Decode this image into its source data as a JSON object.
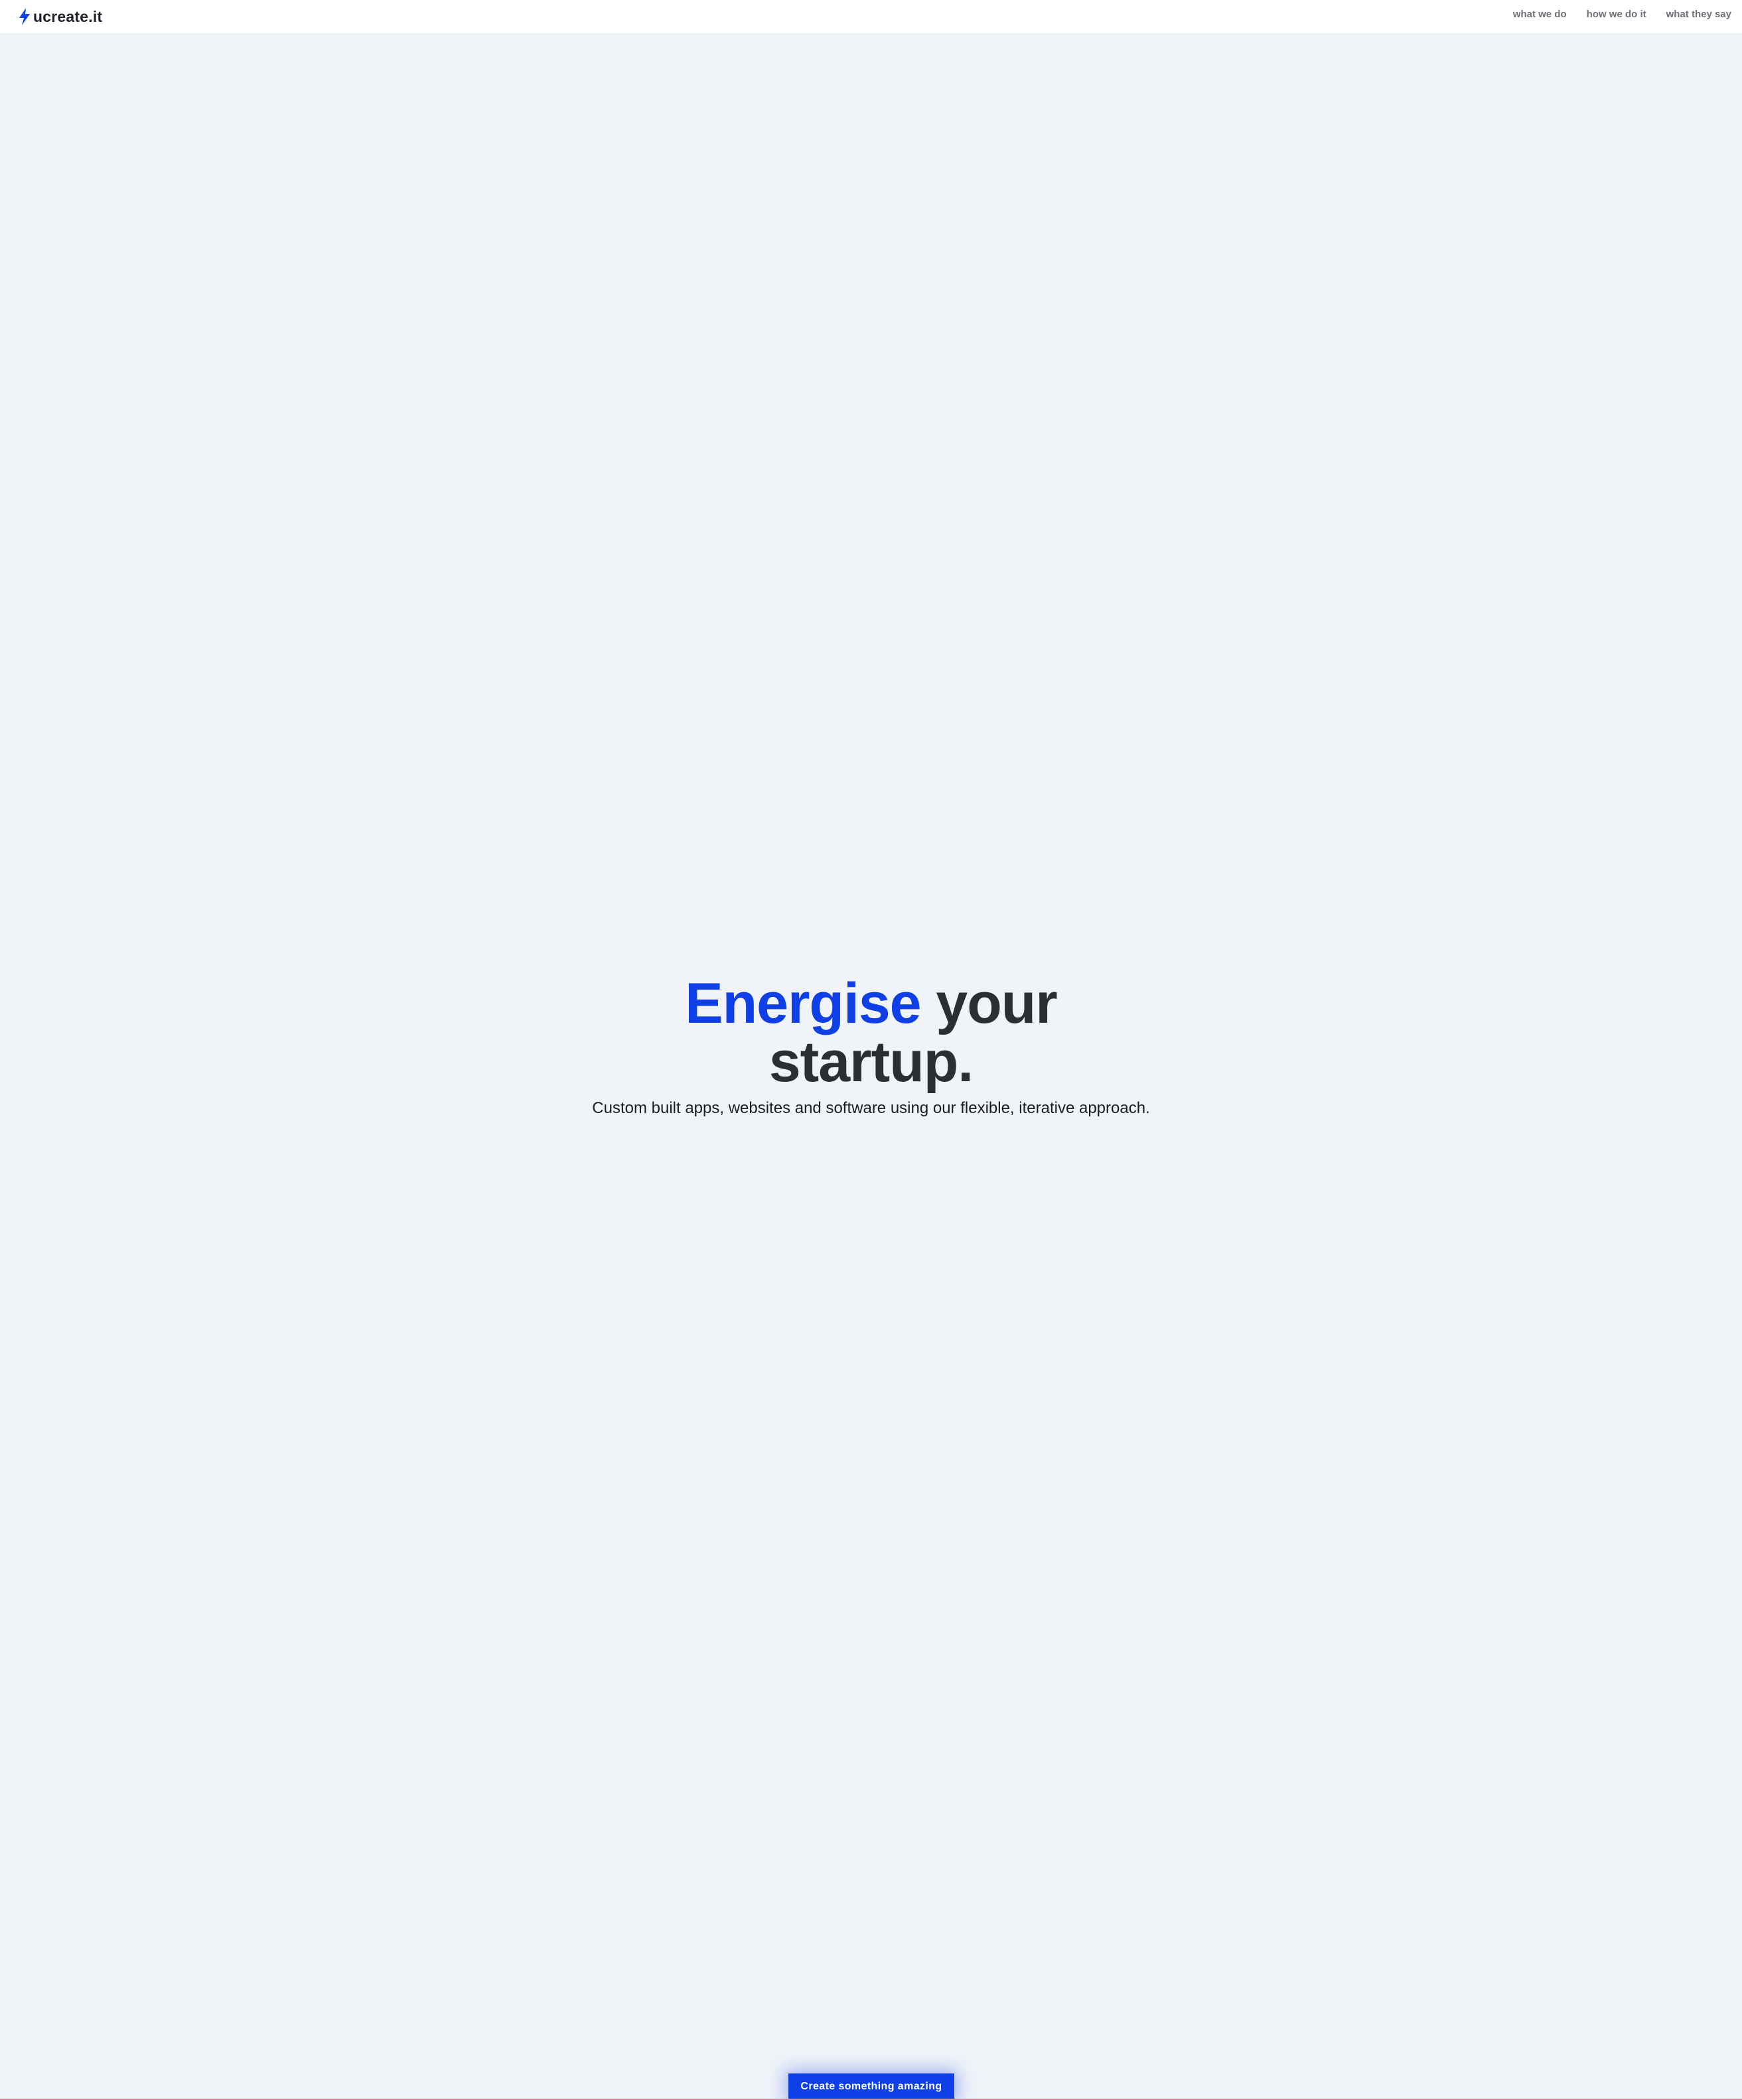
{
  "header": {
    "logo_text": "ucreate.it",
    "logo_icon": "lightning-bolt-icon",
    "nav": [
      {
        "label": "what we do"
      },
      {
        "label": "how we do it"
      },
      {
        "label": "what they say"
      }
    ]
  },
  "hero": {
    "headline_accent": "Energise",
    "headline_rest": "your",
    "headline_line2": "startup.",
    "subtitle": "Custom built apps, websites and software using our flexible, iterative approach."
  },
  "cta": {
    "label": "Create something amazing"
  },
  "colors": {
    "accent": "#0f3fe6",
    "background": "#f0f4f8",
    "heading": "#2b2e33",
    "nav_text": "#6d7178"
  }
}
